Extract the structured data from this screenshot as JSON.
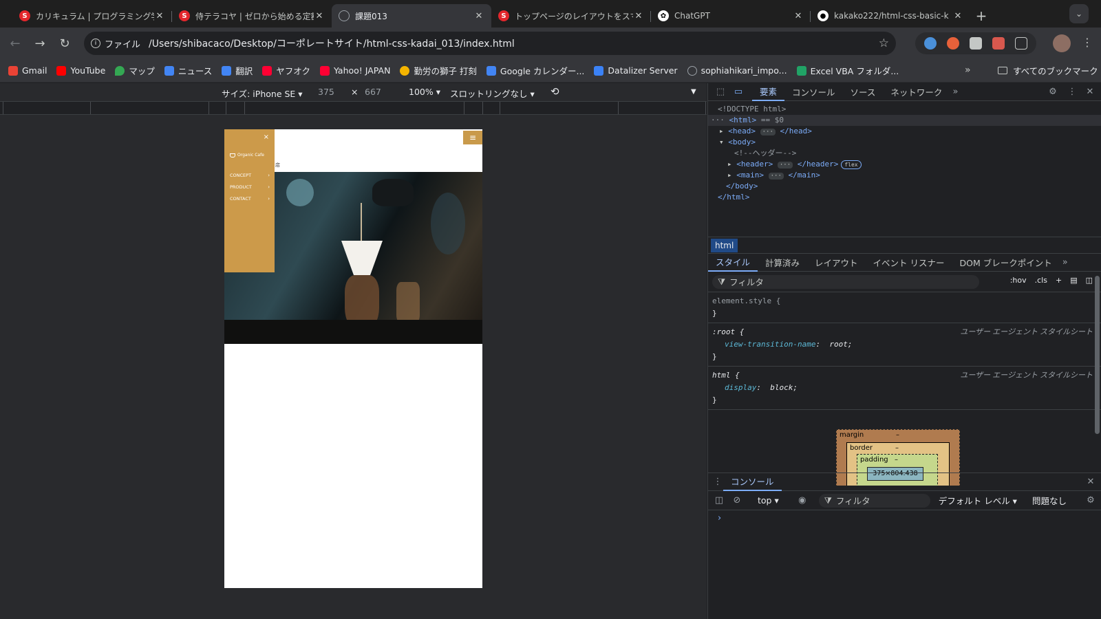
{
  "tabs": [
    {
      "title": "カリキュラム | プログラミング学",
      "icon": "samurai-icon",
      "active": false
    },
    {
      "title": "侍テラコヤ | ゼロから始める定額",
      "icon": "samurai-icon",
      "active": false
    },
    {
      "title": "課題013",
      "icon": "globe-icon",
      "active": true
    },
    {
      "title": "トップページのレイアウトをスマ",
      "icon": "samurai-icon",
      "active": false
    },
    {
      "title": "ChatGPT",
      "icon": "chatgpt-icon",
      "active": false
    },
    {
      "title": "kakako222/html-css-basic-k",
      "icon": "github-icon",
      "active": false
    }
  ],
  "address": {
    "chip": "ファイル",
    "url": "/Users/shibacaco/Desktop/コーポレートサイト/html-css-kadai_013/index.html"
  },
  "bookmarks": [
    {
      "label": "Gmail",
      "color": "#ea4335"
    },
    {
      "label": "YouTube",
      "color": "#ff0000"
    },
    {
      "label": "マップ",
      "color": "#34a853"
    },
    {
      "label": "ニュース",
      "color": "#4285f4"
    },
    {
      "label": "翻訳",
      "color": "#4285f4"
    },
    {
      "label": "ヤフオク",
      "color": "#ff0033"
    },
    {
      "label": "Yahoo! JAPAN",
      "color": "#ff0033"
    },
    {
      "label": "勤労の獅子 打刻",
      "color": "#f4b400"
    },
    {
      "label": "Google カレンダー...",
      "color": "#4285f4"
    },
    {
      "label": "Datalizer Server",
      "color": "#3b82f6"
    },
    {
      "label": "sophiahikari_impo...",
      "color": "#9aa0a6"
    },
    {
      "label": "Excel VBA フォルダ...",
      "color": "#21a366"
    }
  ],
  "bookmarks_all": "すべてのブックマーク",
  "device_toolbar": {
    "size_label": "サイズ: iPhone SE ▾",
    "width": "375",
    "times": "×",
    "height": "667",
    "zoom": "100% ▾",
    "throttle": "スロットリングなし ▾"
  },
  "phone": {
    "menu_icon": "≡",
    "close_icon": "×",
    "logo": "Organic Cafe",
    "peek_text": "店",
    "nav": [
      "CONCEPT",
      "PRODUCT",
      "CONTACT"
    ]
  },
  "devtools": {
    "tabs": [
      "要素",
      "コンソール",
      "ソース",
      "ネットワーク"
    ],
    "dom": {
      "doctype": "<!DOCTYPE html>",
      "html_open": "<html>",
      "eq_selected": " == $0",
      "head": "<head>",
      "head_close": "</head>",
      "body_open": "<body>",
      "comment": "<!--ヘッダー-->",
      "header": "<header>",
      "header_close": "</header>",
      "flex_badge": "flex",
      "main": "<main>",
      "main_close": "</main>",
      "body_close": "</body>",
      "html_close": "</html>",
      "ellipsis": "···"
    },
    "breadcrumb": "html",
    "style_tabs": [
      "スタイル",
      "計算済み",
      "レイアウト",
      "イベント リスナー",
      "DOM ブレークポイント"
    ],
    "filter_placeholder": "フィルタ",
    "hov": ":hov",
    "cls": ".cls",
    "rules": {
      "element_style": "element.style {",
      "close": "}",
      "root_selector": ":root {",
      "root_prop": "view-transition-name",
      "root_val": "root;",
      "html_selector": "html {",
      "html_prop": "display",
      "html_val": "block;",
      "ua_source": "ユーザー エージェント スタイルシート"
    },
    "box_model": {
      "margin": "margin",
      "border": "border",
      "padding": "padding",
      "content": "375×804.438",
      "dash": "–"
    },
    "console": {
      "title": "コンソール",
      "context": "top ▾",
      "filter": "フィルタ",
      "level": "デフォルト レベル ▾",
      "issues": "問題なし",
      "prompt": "›"
    }
  }
}
